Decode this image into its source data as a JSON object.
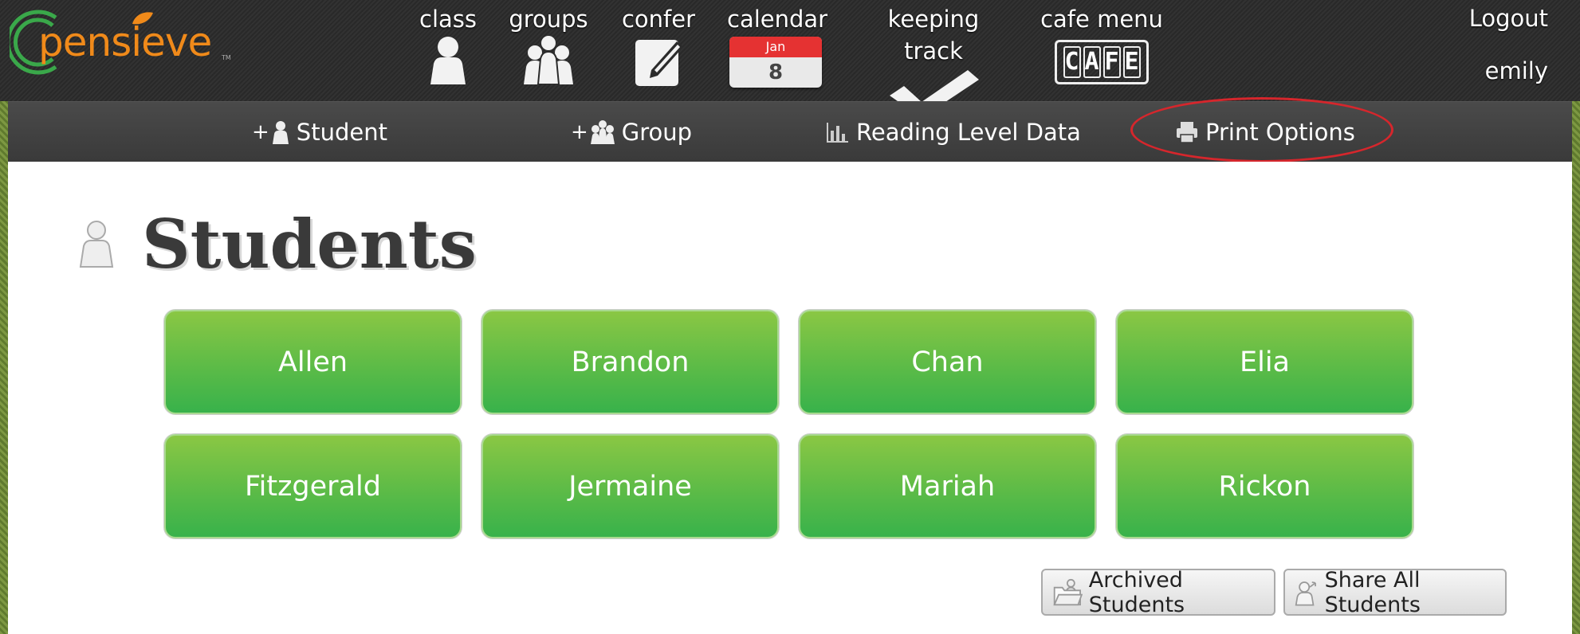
{
  "app": {
    "logo_text": "pensieve",
    "logo_tm": "TM"
  },
  "nav": [
    {
      "label": "class",
      "icon": "person-icon"
    },
    {
      "label": "groups",
      "icon": "group-icon"
    },
    {
      "label": "confer",
      "icon": "notepad-pencil-icon"
    },
    {
      "label": "calendar",
      "icon": "calendar-icon",
      "month": "Jan",
      "day": "8"
    },
    {
      "label": "keeping track",
      "icon": "checkmark-icon"
    },
    {
      "label": "cafe menu",
      "icon": "cafe-icon",
      "letters": [
        "C",
        "A",
        "F",
        "E"
      ]
    }
  ],
  "user": {
    "logout_label": "Logout",
    "username": "emily"
  },
  "subnav": {
    "add_student": {
      "plus": "+",
      "label": "Student"
    },
    "add_group": {
      "plus": "+",
      "label": "Group"
    },
    "reading_level": {
      "label": "Reading Level Data"
    },
    "print_options": {
      "label": "Print Options"
    }
  },
  "page": {
    "title": "Students"
  },
  "students": [
    "Allen",
    "Brandon",
    "Chan",
    "Elia",
    "Fitzgerald",
    "Jermaine",
    "Mariah",
    "Rickon"
  ],
  "actions": {
    "archived_label": "Archived Students",
    "share_label": "Share All Students"
  },
  "colors": {
    "brand_orange": "#f08a1a",
    "brand_green": "#3aa84a",
    "button_green": "#5cbb47",
    "highlight_red": "#d6262c",
    "calendar_red": "#e53232"
  }
}
